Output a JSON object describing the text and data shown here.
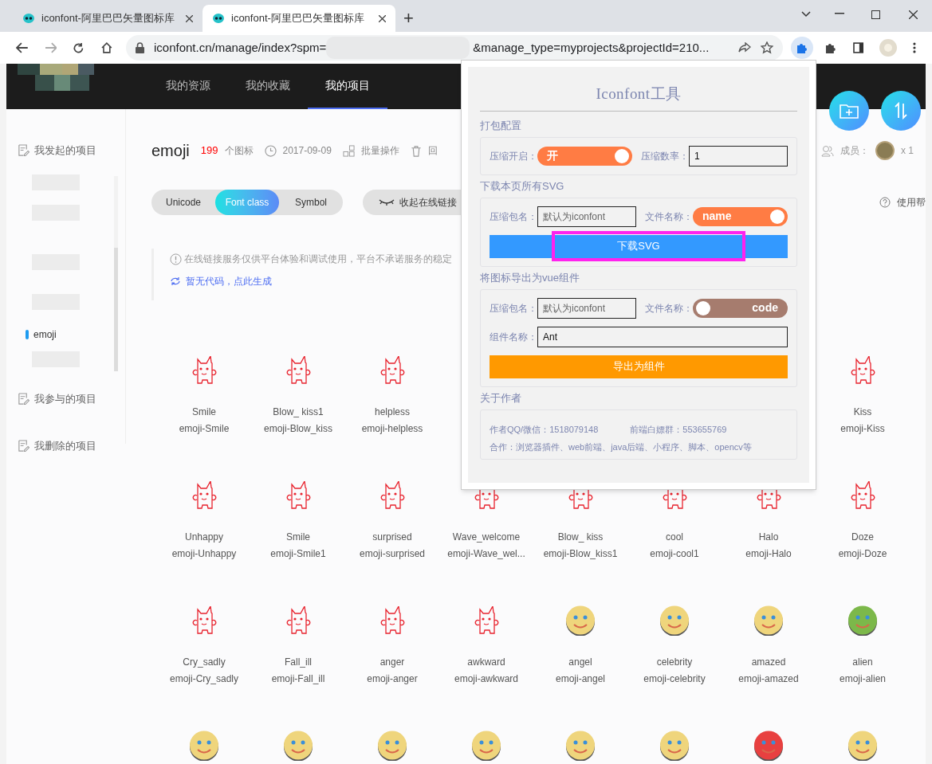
{
  "browser": {
    "tabs": [
      {
        "title": "iconfont-阿里巴巴矢量图标库",
        "selected": false
      },
      {
        "title": "iconfont-阿里巴巴矢量图标库",
        "selected": true
      }
    ],
    "new_tab": "+",
    "url_start": "iconfont.cn/manage/index?spm=",
    "url_end": "&manage_type=myprojects&projectId=210..."
  },
  "nav": [
    {
      "label": "我的资源",
      "selected": false
    },
    {
      "label": "我的收藏",
      "selected": false
    },
    {
      "label": "我的项目",
      "selected": true
    }
  ],
  "sidebar": {
    "owned_title": "我发起的项目",
    "projects": [
      {
        "label": "emoji",
        "selected": true
      }
    ],
    "joined_title": "我参与的项目",
    "deleted_title": "我删除的项目"
  },
  "project": {
    "name": "emoji",
    "count": "199",
    "count_unit": "个图标",
    "date": "2017-09-09",
    "batch": "批量操作",
    "recycle": "回",
    "members_label": "成员：",
    "members_count": "x 1",
    "help": "使用帮"
  },
  "code_tabs": [
    {
      "label": "Unicode",
      "selected": false
    },
    {
      "label": "Font class",
      "selected": true
    },
    {
      "label": "Symbol",
      "selected": false
    }
  ],
  "collapse_link": "收起在线链接",
  "notice": "在线链接服务仅供平台体验和调试使用，平台不承诺服务的稳定",
  "generate_link": "暂无代码，点此生成",
  "icons": [
    [
      {
        "kind": "monster",
        "name": "Smile",
        "code": "emoji-Smile"
      },
      {
        "kind": "monster",
        "name": "Blow_ kiss1",
        "code": "emoji-Blow_kiss"
      },
      {
        "kind": "monster",
        "name": "helpless",
        "code": "emoji-helpless"
      },
      {
        "kind": "monster",
        "name": "Kiss",
        "code": "emoji-Kiss"
      }
    ],
    [
      {
        "kind": "monster",
        "name": "Unhappy",
        "code": "emoji-Unhappy"
      },
      {
        "kind": "monster",
        "name": "Smile",
        "code": "emoji-Smile1"
      },
      {
        "kind": "monster",
        "name": "surprised",
        "code": "emoji-surprised"
      },
      {
        "kind": "monster",
        "name": "Wave_welcome",
        "code": "emoji-Wave_wel..."
      },
      {
        "kind": "monster",
        "name": "Blow_ kiss",
        "code": "emoji-Blow_kiss1"
      },
      {
        "kind": "monster",
        "name": "cool",
        "code": "emoji-cool1"
      },
      {
        "kind": "monster",
        "name": "Halo",
        "code": "emoji-Halo"
      },
      {
        "kind": "monster",
        "name": "Doze",
        "code": "emoji-Doze"
      }
    ],
    [
      {
        "kind": "monster",
        "name": "Cry_sadly",
        "code": "emoji-Cry_sadly"
      },
      {
        "kind": "monster",
        "name": "Fall_ill",
        "code": "emoji-Fall_ill"
      },
      {
        "kind": "monster",
        "name": "anger",
        "code": "emoji-anger"
      },
      {
        "kind": "monster",
        "name": "awkward",
        "code": "emoji-awkward"
      },
      {
        "kind": "face",
        "color": "#efd57c",
        "name": "angel",
        "code": "emoji-angel"
      },
      {
        "kind": "face",
        "color": "#efd57c",
        "name": "celebrity",
        "code": "emoji-celebrity"
      },
      {
        "kind": "face",
        "color": "#efd57c",
        "name": "amazed",
        "code": "emoji-amazed"
      },
      {
        "kind": "face",
        "color": "#7cb84a",
        "name": "alien",
        "code": "emoji-alien"
      }
    ],
    [
      {
        "kind": "face",
        "color": "#efd57c"
      },
      {
        "kind": "face",
        "color": "#efd57c"
      },
      {
        "kind": "face",
        "color": "#efd57c"
      },
      {
        "kind": "face",
        "color": "#efd57c"
      },
      {
        "kind": "face",
        "color": "#efd57c"
      },
      {
        "kind": "face",
        "color": "#efd57c"
      },
      {
        "kind": "face",
        "color": "#e84040"
      },
      {
        "kind": "face",
        "color": "#efd57c"
      }
    ]
  ],
  "popup": {
    "title": "Iconfont工具",
    "sections": [
      {
        "title": "打包配置",
        "rows": [
          [
            {
              "kind": "label",
              "text": "压缩开启："
            },
            {
              "kind": "toggle",
              "label": "开",
              "on": true
            },
            {
              "kind": "label",
              "text": "压缩数率："
            },
            {
              "kind": "input",
              "value": "1"
            }
          ]
        ]
      },
      {
        "title": "下载本页所有SVG",
        "rows": [
          [
            {
              "kind": "label",
              "text": "压缩包名："
            },
            {
              "kind": "input",
              "placeholder": "默认为iconfont"
            },
            {
              "kind": "label",
              "text": "文件名称："
            },
            {
              "kind": "toggle",
              "label": "name",
              "on": true
            }
          ]
        ],
        "button": {
          "label": "下载SVG",
          "color": "#3399ff",
          "highlighted": true
        }
      },
      {
        "title": "将图标导出为vue组件",
        "rows": [
          [
            {
              "kind": "label",
              "text": "压缩包名："
            },
            {
              "kind": "input",
              "placeholder": "默认为iconfont"
            },
            {
              "kind": "label",
              "text": "文件名称："
            },
            {
              "kind": "toggle",
              "label": "code",
              "on": false
            }
          ],
          [
            {
              "kind": "label",
              "text": "组件名称："
            },
            {
              "kind": "input",
              "value": "Ant"
            }
          ]
        ],
        "button": {
          "label": "导出为组件",
          "color": "#ff9900"
        }
      },
      {
        "title": "关于作者",
        "info": [
          [
            "作者QQ/微信：1518079148",
            "前端白嫖群：553655769"
          ],
          [
            "合作：浏览器插件、web前端、java后端、小程序、脚本、opencv等"
          ]
        ]
      }
    ]
  }
}
